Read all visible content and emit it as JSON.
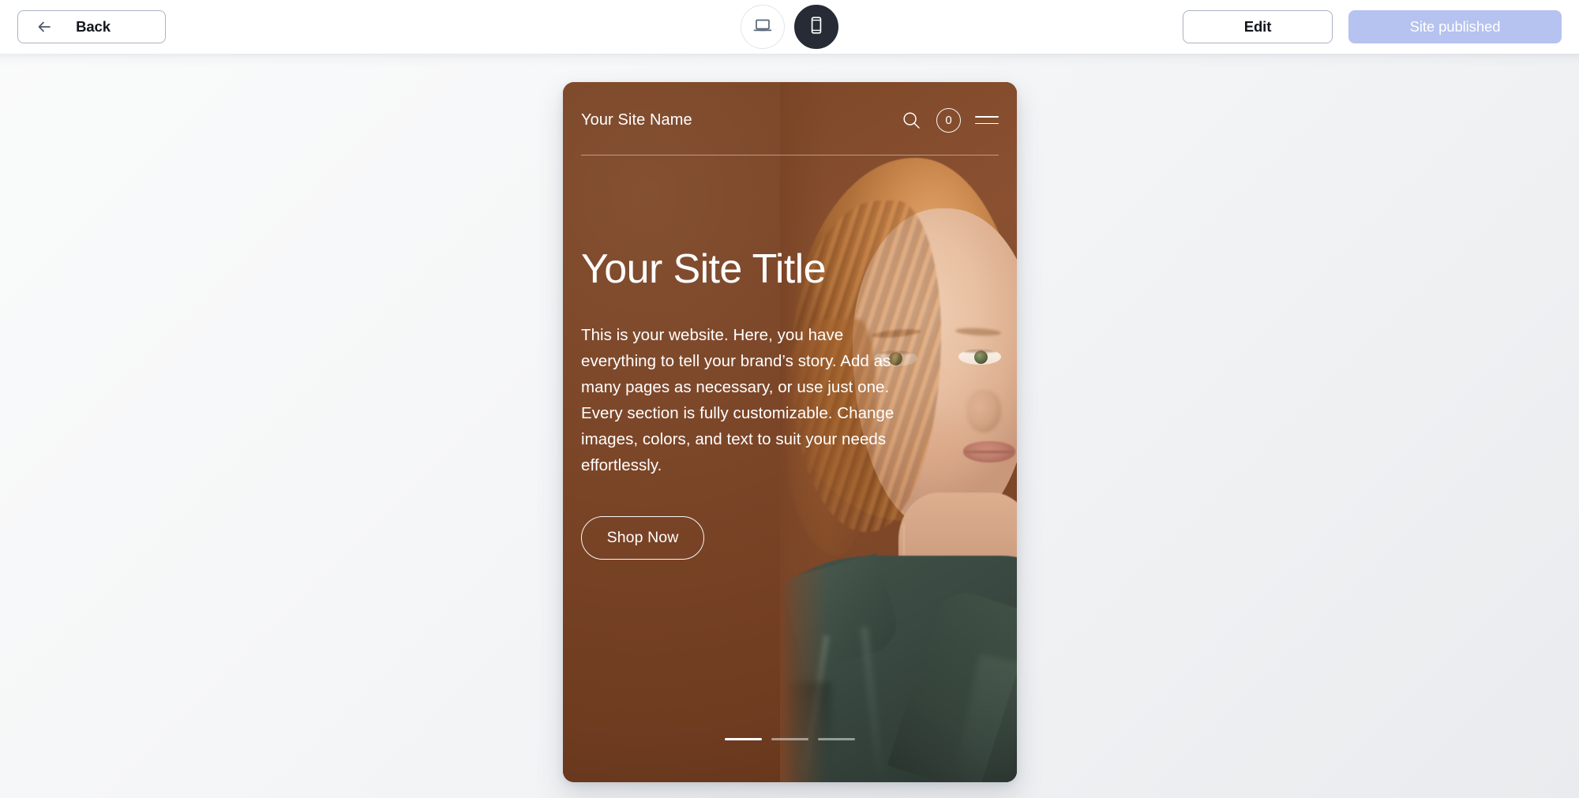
{
  "toolbar": {
    "back_label": "Back",
    "back_icon": "arrow-left-icon",
    "edit_label": "Edit",
    "publish_label": "Site published",
    "devices": [
      {
        "id": "desktop",
        "icon": "laptop-icon",
        "selected": false
      },
      {
        "id": "mobile",
        "icon": "smartphone-icon",
        "selected": true
      }
    ]
  },
  "preview": {
    "device": "mobile",
    "site_header": {
      "site_name": "Your Site Name",
      "search_icon": "search-icon",
      "cart_count": "0",
      "menu_icon": "hamburger-menu-icon"
    },
    "hero": {
      "title": "Your Site Title",
      "body": "This is your website. Here, you have everything to tell your brand’s story. Add as many pages as necessary, or use just one. Every section is fully customizable. Change images, colors, and text to suit your needs effortlessly.",
      "cta_label": "Shop Now"
    },
    "carousel": {
      "slides": [
        {
          "index": 1,
          "active": true
        },
        {
          "index": 2,
          "active": false
        },
        {
          "index": 3,
          "active": false
        }
      ]
    }
  },
  "colors": {
    "hero_background": "#7A4426",
    "publish_button": "#B6C2EF",
    "device_active": "#262B36",
    "toolbar_background": "#FFFFFF",
    "canvas_background": "#F4F5F7",
    "jacket_green": "#3A4941"
  }
}
